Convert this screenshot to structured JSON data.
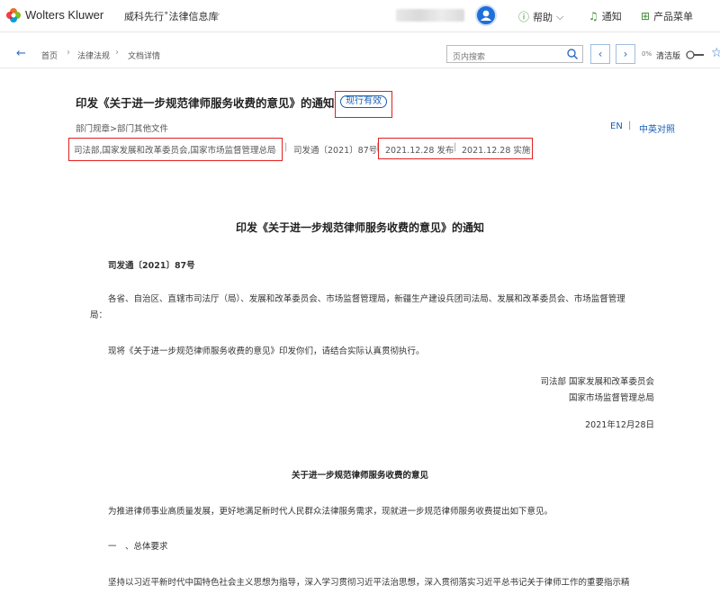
{
  "header": {
    "brand": "Wolters Kluwer",
    "product": "威科先行˚法律信息库",
    "help": "帮助",
    "notifications": "通知",
    "product_menu": "产品菜单",
    "brand_colors": [
      "#e8702a",
      "#85bc20",
      "#009fd9",
      "#ed1c24"
    ]
  },
  "toolbar": {
    "breadcrumb": [
      "首页",
      "法律法规",
      "文档详情"
    ],
    "search_placeholder": "页内搜索",
    "percent": "0%",
    "clean_version": "清洁版"
  },
  "document": {
    "title": "印发《关于进一步规范律师服务收费的意见》的通知",
    "status": "现行有效",
    "category": "部门规章>部门其他文件",
    "lang_en": "EN",
    "lang_bilingual": "中英对照",
    "issuer": "司法部,国家发展和改革委员会,国家市场监督管理总局",
    "doc_number": "司发通〔2021〕87号",
    "published": "2021.12.28 发布",
    "effective": "2021.12.28 实施"
  },
  "content": {
    "heading": "印发《关于进一步规范律师服务收费的意见》的通知",
    "number": "司发通〔2021〕87号",
    "recipients_line1": "各省、自治区、直辖市司法厅（局）、发展和改革委员会、市场监督管理局，新疆生产建设兵团司法局、发展和改革委员会、市场监督管理",
    "recipients_line2": "局：",
    "instruction": "现将《关于进一步规范律师服务收费的意见》印发你们，请结合实际认真贯彻执行。",
    "signatory1": "司法部 国家发展和改革委员会",
    "signatory2": "国家市场监督管理总局",
    "date": "2021年12月28日",
    "opinion_title": "关于进一步规范律师服务收费的意见",
    "intro": "为推进律师事业高质量发展，更好地满足新时代人民群众法律服务需求，现就进一步规范律师服务收费提出如下意见。",
    "section1": "一　、总体要求",
    "section1_text": "坚持以习近平新时代中国特色社会主义思想为指导，深入学习贯彻习近平法治思想，深入贯彻落实习近平总书记关于律师工作的重要指示精"
  }
}
